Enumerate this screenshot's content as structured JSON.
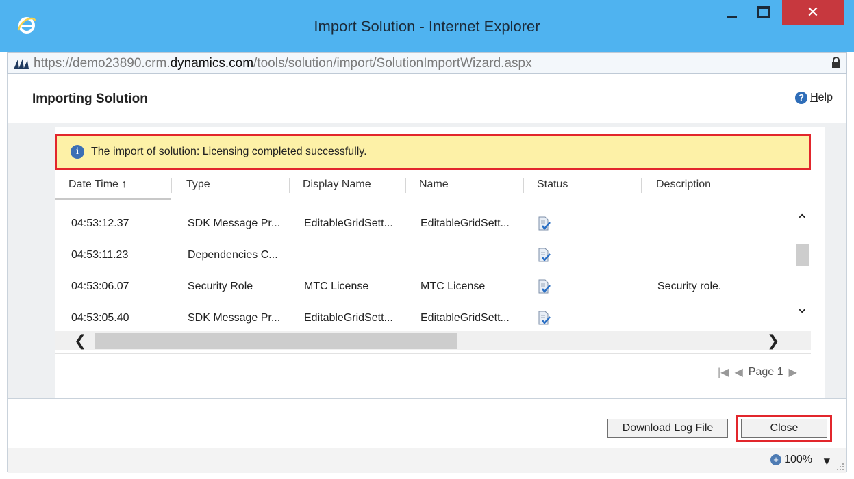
{
  "window": {
    "title": "Import Solution - Internet Explorer",
    "close_glyph": "✕",
    "url_scheme": "https://",
    "url_subdomain": "demo23890.crm.",
    "url_domain": "dynamics.com",
    "url_path": "/tools/solution/import/SolutionImportWizard.aspx"
  },
  "header": {
    "title": "Importing Solution",
    "help_glyph": "?",
    "help_label": "Help"
  },
  "banner": {
    "icon_glyph": "i",
    "message": "The import of solution: Licensing completed successfully."
  },
  "grid": {
    "columns": [
      {
        "label": "Date Time ↑"
      },
      {
        "label": "Type"
      },
      {
        "label": "Display Name"
      },
      {
        "label": "Name"
      },
      {
        "label": "Status"
      },
      {
        "label": "Description"
      }
    ],
    "rows": [
      {
        "datetime": "04:53:12.37",
        "type": "SDK Message Pr...",
        "display_name": "EditableGridSett...",
        "name": "EditableGridSett...",
        "status": "status-completed-icon",
        "description": ""
      },
      {
        "datetime": "04:53:11.23",
        "type": "Dependencies C...",
        "display_name": "",
        "name": "",
        "status": "status-completed-icon",
        "description": ""
      },
      {
        "datetime": "04:53:06.07",
        "type": "Security Role",
        "display_name": "MTC License",
        "name": "MTC License",
        "status": "status-completed-icon",
        "description": "Security role."
      },
      {
        "datetime": "04:53:05.40",
        "type": "SDK Message Pr...",
        "display_name": "EditableGridSett...",
        "name": "EditableGridSett...",
        "status": "status-completed-icon",
        "description": ""
      }
    ],
    "scroll_up": "⌃",
    "scroll_down": "⌄",
    "scroll_left": "❮",
    "scroll_right": "❯",
    "pager_first": "|◀",
    "pager_prev": "◀",
    "pager_label": "Page 1",
    "pager_next": "▶"
  },
  "footer": {
    "download_label": "Download Log File",
    "close_label": "Close"
  },
  "statusbar": {
    "zoom_glyph": "+",
    "zoom_level": "100%",
    "zoom_caret": "▼"
  },
  "colors": {
    "titlebar": "#4fb3f0",
    "close": "#c7383e",
    "banner": "#fdf1a7",
    "highlight": "#e2262c"
  }
}
